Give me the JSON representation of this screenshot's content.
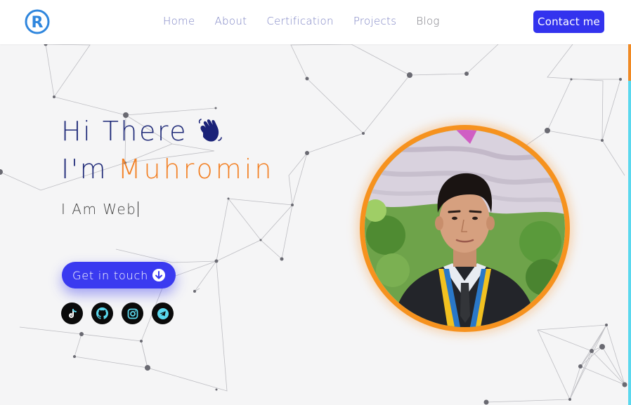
{
  "nav": {
    "logo_letter": "R",
    "links": [
      "Home",
      "About",
      "Certification",
      "Projects",
      "Blog"
    ],
    "contact_label": "Contact me"
  },
  "hero": {
    "greeting": "Hi There",
    "name_prefix": "I'm",
    "name": "Muhromin",
    "typed_text": "I Am Web",
    "cta_label": "Get in touch"
  },
  "socials": [
    "tiktok-icon",
    "github-icon",
    "instagram-icon",
    "telegram-icon"
  ],
  "colors": {
    "accent_blue": "#3333ee",
    "accent_orange": "#f27f22",
    "heading_navy": "#1f2a78",
    "nav_link": "#7f85c5",
    "social_bg": "#0b0b0b",
    "social_icon": "#5ad8ee"
  }
}
